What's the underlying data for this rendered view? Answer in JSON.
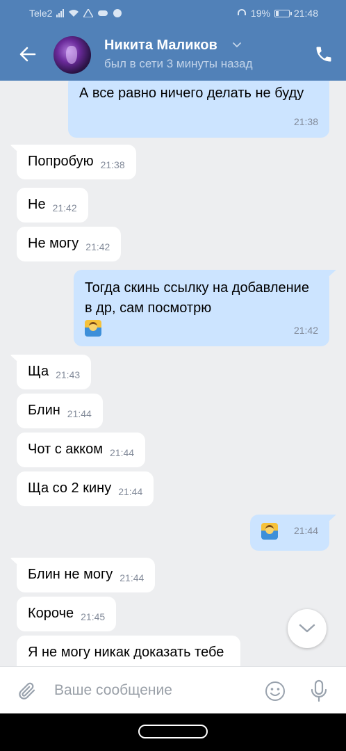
{
  "status_bar": {
    "carrier": "Tele2",
    "battery": "19%",
    "time": "21:48"
  },
  "header": {
    "contact_name": "Никита Маликов",
    "contact_status": "был в сети 3 минуты назад"
  },
  "messages": [
    {
      "dir": "out",
      "text": "А все равно ничего делать не буду",
      "time": "21:38"
    },
    {
      "dir": "in",
      "text": "Попробую",
      "time": "21:38"
    },
    {
      "dir": "in",
      "text": "Не",
      "time": "21:42"
    },
    {
      "dir": "in",
      "text": "Не могу",
      "time": "21:42"
    },
    {
      "dir": "out",
      "text": "Тогда скинь ссылку на добавление в др, сам посмотрю",
      "emoji": "man-shrugging",
      "time": "21:42"
    },
    {
      "dir": "in",
      "text": "Ща",
      "time": "21:43"
    },
    {
      "dir": "in",
      "text": "Блин",
      "time": "21:44"
    },
    {
      "dir": "in",
      "text": "Чот с акком",
      "time": "21:44"
    },
    {
      "dir": "in",
      "text": "Ща со 2 кину",
      "time": "21:44"
    },
    {
      "dir": "out",
      "text": "",
      "emoji": "man-shrugging",
      "time": "21:44"
    },
    {
      "dir": "in",
      "text": "Блин не могу",
      "time": "21:44"
    },
    {
      "dir": "in",
      "text": "Короче",
      "time": "21:45"
    },
    {
      "dir": "in",
      "text": "Я не могу никак доказать тебе",
      "time": ""
    }
  ],
  "composer": {
    "placeholder": "Ваше сообщение",
    "value": ""
  },
  "colors": {
    "header_bg": "#5181b8",
    "chat_bg": "#edeef0",
    "incoming_bubble": "#ffffff",
    "outgoing_bubble": "#cce4ff",
    "time_text": "#828a99"
  },
  "icons": {
    "back": "arrow-left-icon",
    "chevron": "chevron-down-icon",
    "call": "phone-icon",
    "attach": "paperclip-icon",
    "emoji": "smiley-icon",
    "mic": "microphone-icon",
    "scroll": "chevron-down-icon"
  }
}
